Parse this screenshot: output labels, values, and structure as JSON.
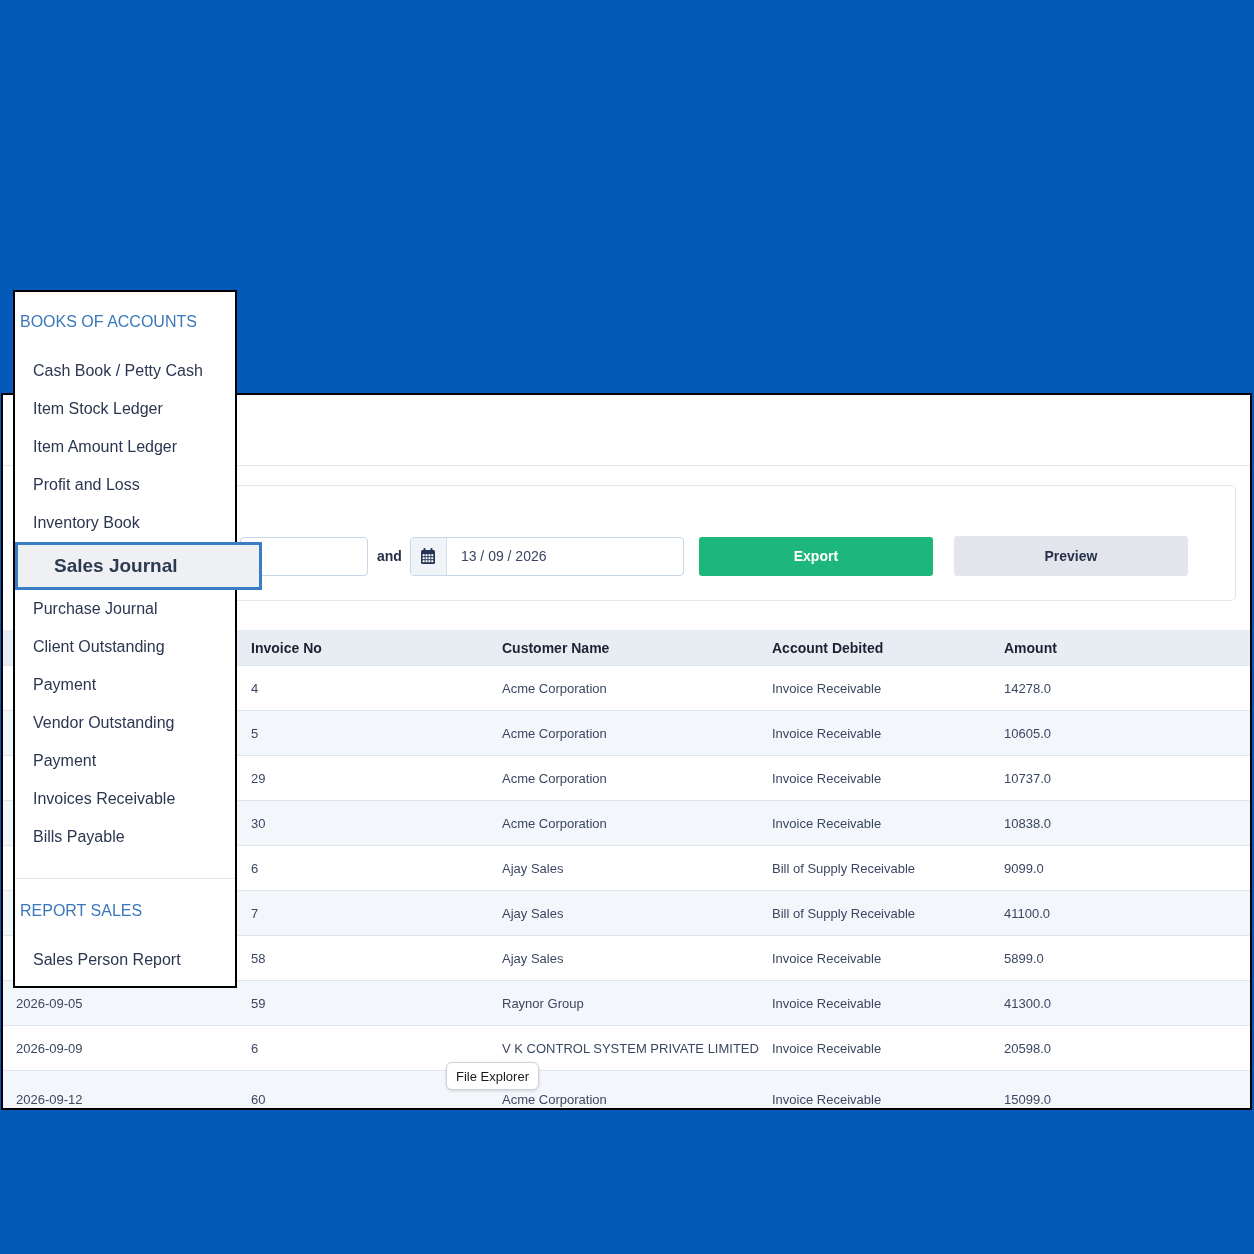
{
  "menu": {
    "sections": [
      {
        "heading": "BOOKS OF ACCOUNTS",
        "items": [
          {
            "label": "Cash Book / Petty Cash",
            "selected": false
          },
          {
            "label": "Item Stock Ledger",
            "selected": false
          },
          {
            "label": "Item Amount Ledger",
            "selected": false
          },
          {
            "label": "Profit and Loss",
            "selected": false
          },
          {
            "label": "Inventory Book",
            "selected": false
          },
          {
            "label": "Sales Journal",
            "selected": true
          },
          {
            "label": "Purchase Journal",
            "selected": false
          },
          {
            "label": "Client Outstanding",
            "selected": false
          },
          {
            "label": "Payment",
            "selected": false
          },
          {
            "label": "Vendor Outstanding",
            "selected": false
          },
          {
            "label": "Payment",
            "selected": false
          },
          {
            "label": "Invoices Receivable",
            "selected": false
          },
          {
            "label": "Bills Payable",
            "selected": false
          }
        ]
      },
      {
        "heading": "REPORT SALES",
        "items": [
          {
            "label": "Sales Person Report",
            "selected": false
          }
        ]
      }
    ]
  },
  "filters": {
    "joiner": "and",
    "date_to": {
      "value": "13 / 09 / 2026"
    },
    "buttons": [
      {
        "label": "Export",
        "kind": "primary"
      },
      {
        "label": "Preview",
        "kind": "secondary"
      }
    ]
  },
  "table": {
    "columns": [
      "Invoice No",
      "Customer Name",
      "Account Debited",
      "Amount"
    ],
    "rows": [
      {
        "invoice_no": "4",
        "customer_name": "Acme Corporation",
        "account_debited": "Invoice Receivable",
        "amount": "14278.0"
      },
      {
        "invoice_no": "5",
        "customer_name": "Acme Corporation",
        "account_debited": "Invoice Receivable",
        "amount": "10605.0"
      },
      {
        "invoice_no": "29",
        "customer_name": "Acme Corporation",
        "account_debited": "Invoice Receivable",
        "amount": "10737.0"
      },
      {
        "invoice_no": "30",
        "customer_name": "Acme Corporation",
        "account_debited": "Invoice Receivable",
        "amount": "10838.0"
      },
      {
        "invoice_no": "6",
        "customer_name": "Ajay Sales",
        "account_debited": "Bill of Supply Receivable",
        "amount": "9099.0"
      },
      {
        "invoice_no": "7",
        "customer_name": "Ajay Sales",
        "account_debited": "Bill of Supply Receivable",
        "amount": "41100.0"
      },
      {
        "invoice_no": "58",
        "customer_name": "Ajay Sales",
        "account_debited": "Invoice Receivable",
        "amount": "5899.0"
      },
      {
        "column_1": "2026-09-05",
        "invoice_no": "59",
        "customer_name": "Raynor Group",
        "account_debited": "Invoice Receivable",
        "amount": "41300.0"
      },
      {
        "column_1": "2026-09-09",
        "invoice_no": "6",
        "customer_name": "V K CONTROL SYSTEM PRIVATE LIMITED",
        "account_debited": "Invoice Receivable",
        "amount": "20598.0"
      },
      {
        "column_1": "2026-09-12",
        "invoice_no": "60",
        "customer_name": "Acme Corporation",
        "account_debited": "Invoice Receivable",
        "amount": "15099.0"
      }
    ]
  },
  "tooltip": {
    "text": "File Explorer"
  }
}
